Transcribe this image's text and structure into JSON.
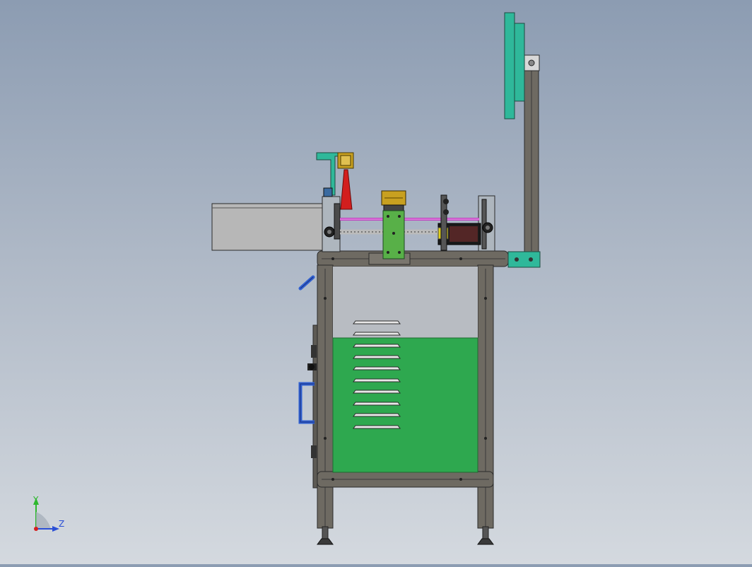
{
  "view": {
    "background_top": "#8c9cb2",
    "background_bottom": "#d4d9df"
  },
  "triad": {
    "y_label": "Y",
    "z_label": "Z",
    "y_color": "#2eb82e",
    "z_color": "#2b4fd6",
    "origin_color": "#d42020"
  },
  "model": {
    "frame_color": "#6e6a62",
    "panel_color": "#2ea84f",
    "display_color": "#2fb89a",
    "laser_color": "#d21e1e",
    "rod_color": "#c040c0",
    "handle_color": "#3060d0",
    "box_color": "#b7b7b7",
    "camera_color": "#c8a020",
    "carriage_color": "#58b048"
  }
}
